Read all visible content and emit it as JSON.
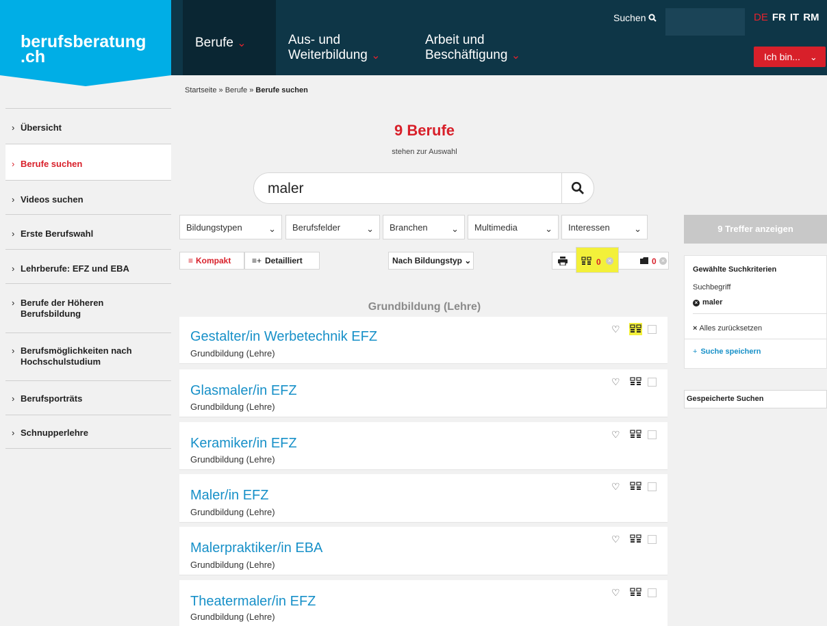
{
  "header": {
    "logo_line1": "berufsberatung",
    "logo_line2": ".ch",
    "nav": [
      {
        "line1": "Berufe",
        "line2": ""
      },
      {
        "line1": "Aus- und",
        "line2": "Weiterbildung"
      },
      {
        "line1": "Arbeit und",
        "line2": "Beschäftigung"
      }
    ],
    "search_label": "Suchen",
    "languages": [
      "DE",
      "FR",
      "IT",
      "RM"
    ],
    "ich_bin": "Ich bin...",
    "colors": {
      "header_bg": "#0e3647",
      "logo_bg": "#00aee6",
      "accent": "#d8202a"
    }
  },
  "breadcrumb": {
    "home": "Startseite",
    "sep": "»",
    "level1": "Berufe",
    "current": "Berufe suchen"
  },
  "sidebar": {
    "items": [
      {
        "label": "Übersicht"
      },
      {
        "label": "Berufe suchen"
      },
      {
        "label": "Videos suchen"
      },
      {
        "label": "Erste Berufswahl"
      },
      {
        "label": "Lehrberufe: EFZ und EBA"
      },
      {
        "label": "Berufe der Höheren Berufsbildung"
      },
      {
        "label": "Berufsmöglichkeiten nach Hochschulstudium"
      },
      {
        "label": "Berufsporträts"
      },
      {
        "label": "Schnupperlehre"
      }
    ]
  },
  "results": {
    "count": "9 Berufe",
    "subtitle": "stehen zur Auswahl"
  },
  "search": {
    "value": "maler"
  },
  "filters": [
    "Bildungstypen",
    "Berufsfelder",
    "Branchen",
    "Multimedia",
    "Interessen"
  ],
  "view": {
    "compact": "Kompakt",
    "detailed": "Detailliert",
    "sort": "Nach Bildungstyp"
  },
  "tools": {
    "compare_count": "0",
    "saved_count": "0"
  },
  "group": {
    "title": "Grundbildung (Lehre)"
  },
  "list": [
    {
      "title": "Gestalter/in Werbetechnik EFZ",
      "sub": "Grundbildung (Lehre)"
    },
    {
      "title": "Glasmaler/in EFZ",
      "sub": "Grundbildung (Lehre)"
    },
    {
      "title": "Keramiker/in EFZ",
      "sub": "Grundbildung (Lehre)"
    },
    {
      "title": "Maler/in EFZ",
      "sub": "Grundbildung (Lehre)"
    },
    {
      "title": "Malerpraktiker/in EBA",
      "sub": "Grundbildung (Lehre)"
    },
    {
      "title": "Theatermaler/in EFZ",
      "sub": "Grundbildung (Lehre)"
    }
  ],
  "right": {
    "treffer": "9 Treffer anzeigen",
    "criteria_title": "Gewählte Suchkriterien",
    "criteria_label": "Suchbegriff",
    "criteria_term": "maler",
    "reset": "Alles zurücksetzen",
    "save_search": "Suche speichern",
    "saved_searches": "Gespeicherte Suchen"
  }
}
